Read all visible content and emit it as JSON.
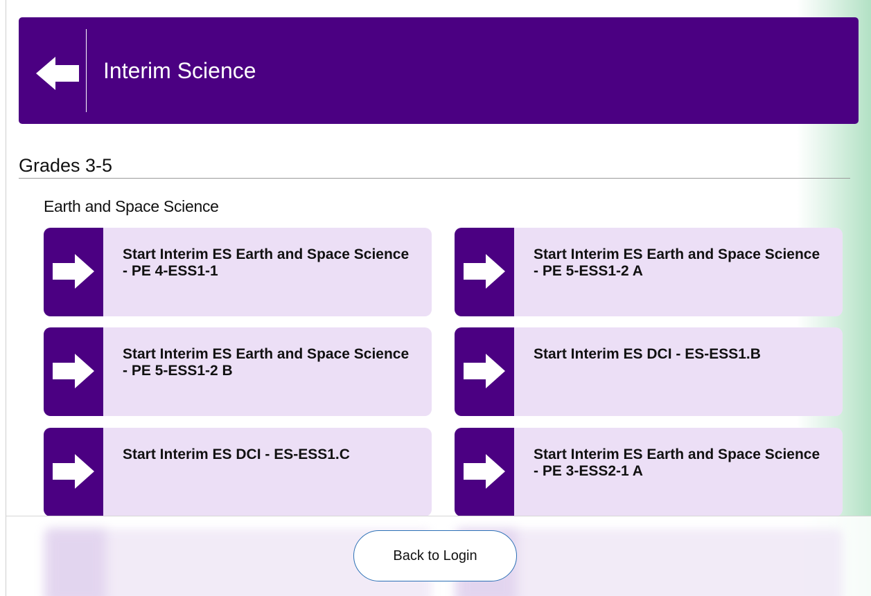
{
  "header": {
    "title": "Interim Science"
  },
  "grade_group": {
    "heading": "Grades 3-5",
    "section": {
      "heading": "Earth and Space Science",
      "tiles": [
        {
          "label": "Start Interim ES Earth and Space Science - PE 4-ESS1-1"
        },
        {
          "label": "Start Interim ES Earth and Space Science - PE 5-ESS1-2 A"
        },
        {
          "label": "Start Interim ES Earth and Space Science - PE 5-ESS1-2 B"
        },
        {
          "label": "Start Interim ES DCI - ES-ESS1.B"
        },
        {
          "label": "Start Interim ES DCI - ES-ESS1.C"
        },
        {
          "label": "Start Interim ES Earth and Space Science - PE 3-ESS2-1 A"
        }
      ]
    }
  },
  "footer": {
    "back_to_login_label": "Back to Login"
  },
  "colors": {
    "brand_purple": "#4b0082",
    "tile_background": "#ecdff6",
    "button_border": "#2a6fb5"
  },
  "icons": {
    "header_back": "back-arrow-icon",
    "tile_start": "right-arrow-icon"
  }
}
